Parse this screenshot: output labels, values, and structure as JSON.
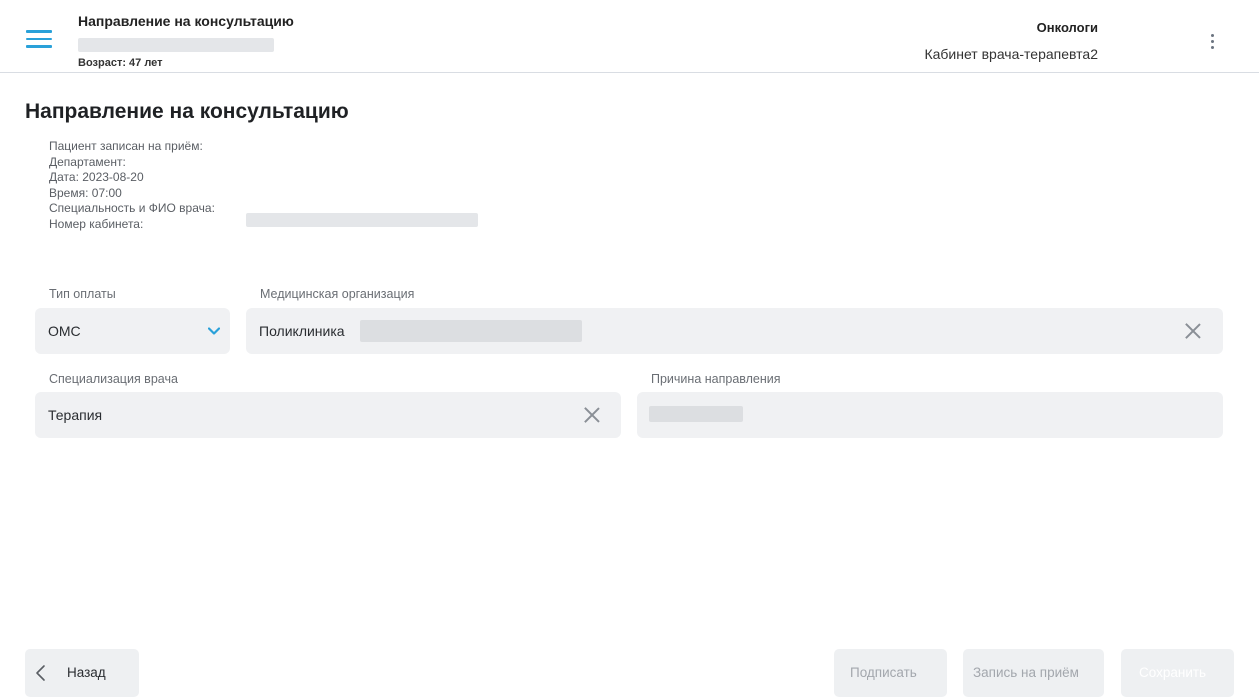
{
  "header": {
    "title": "Направление на консультацию",
    "age": "Возраст: 47 лет",
    "organization": "Онкологи",
    "cabinet": "Кабинет врача-терапевта2",
    "menu_icon": "hamburger-menu-icon",
    "more_icon": "more-vertical-icon"
  },
  "main": {
    "title": "Направление на консультацию",
    "info": {
      "patient_line": "Пациент записан на приём:",
      "department": "Департамент:",
      "date": "Дата: 2023-08-20",
      "time": "Время: 07:00",
      "doctor": "Специальность и ФИО врача:",
      "room": "Номер кабинета:"
    }
  },
  "form": {
    "payment_type": {
      "label": "Тип оплаты",
      "value": "ОМС"
    },
    "medical_org": {
      "label": "Медицинская организация",
      "value": "Поликлиника"
    },
    "specialization": {
      "label": "Специализация врача",
      "value": "Терапия"
    },
    "reason": {
      "label": "Причина направления",
      "value": ""
    }
  },
  "footer": {
    "back": "Назад",
    "sign": "Подписать",
    "appointment": "Запись на приём",
    "save": "Сохранить"
  },
  "colors": {
    "accent": "#2aa1d9",
    "field_bg": "#f0f1f3",
    "disabled_text": "#a3a7ad"
  }
}
